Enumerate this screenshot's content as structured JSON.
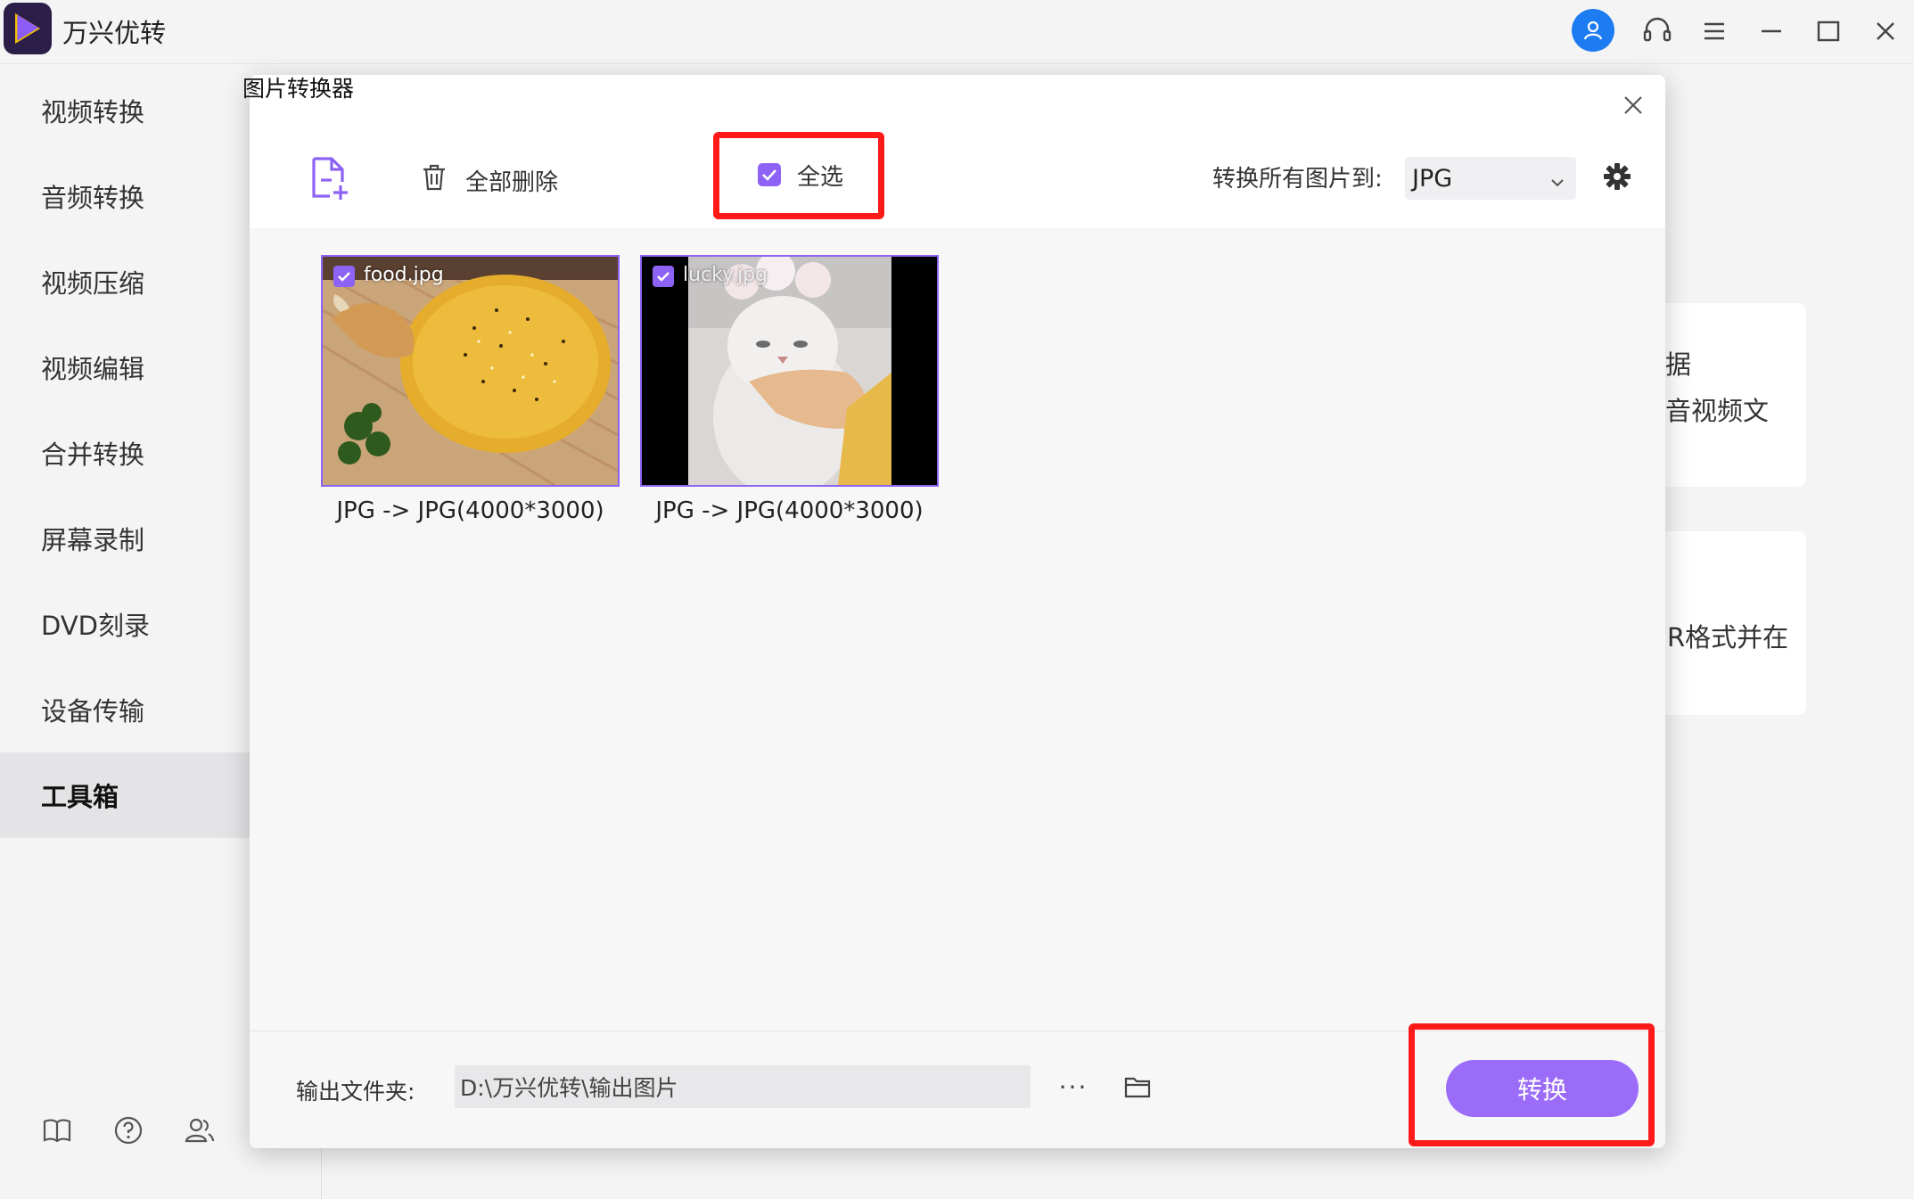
{
  "app": {
    "name": "万兴优转"
  },
  "sidebar": {
    "items": [
      {
        "label": "视频转换"
      },
      {
        "label": "音频转换"
      },
      {
        "label": "视频压缩"
      },
      {
        "label": "视频编辑"
      },
      {
        "label": "合并转换"
      },
      {
        "label": "屏幕录制"
      },
      {
        "label": "DVD刻录"
      },
      {
        "label": "设备传输"
      },
      {
        "label": "工具箱"
      }
    ],
    "active": "工具箱"
  },
  "background_cards": [
    {
      "line1": "据",
      "line2": "音视频文"
    },
    {
      "line1": "R格式并在"
    }
  ],
  "dialog": {
    "title": "图片转换器",
    "toolbar": {
      "delete_all": "全部删除",
      "select_all": "全选",
      "convert_all_label": "转换所有图片到:",
      "format": "JPG"
    },
    "images": [
      {
        "name": "food.jpg",
        "caption": "JPG -> JPG(4000*3000)",
        "checked": true
      },
      {
        "name": "lucky.jpg",
        "caption": "JPG -> JPG(4000*3000)",
        "checked": true
      }
    ],
    "footer": {
      "output_label": "输出文件夹:",
      "output_path": "D:\\万兴优转\\输出图片",
      "more": "···",
      "convert": "转换"
    }
  },
  "colors": {
    "accent": "#8d63f5",
    "button": "#9b6cf8",
    "highlight": "#ff1a1a",
    "avatar": "#1d7cf2"
  }
}
